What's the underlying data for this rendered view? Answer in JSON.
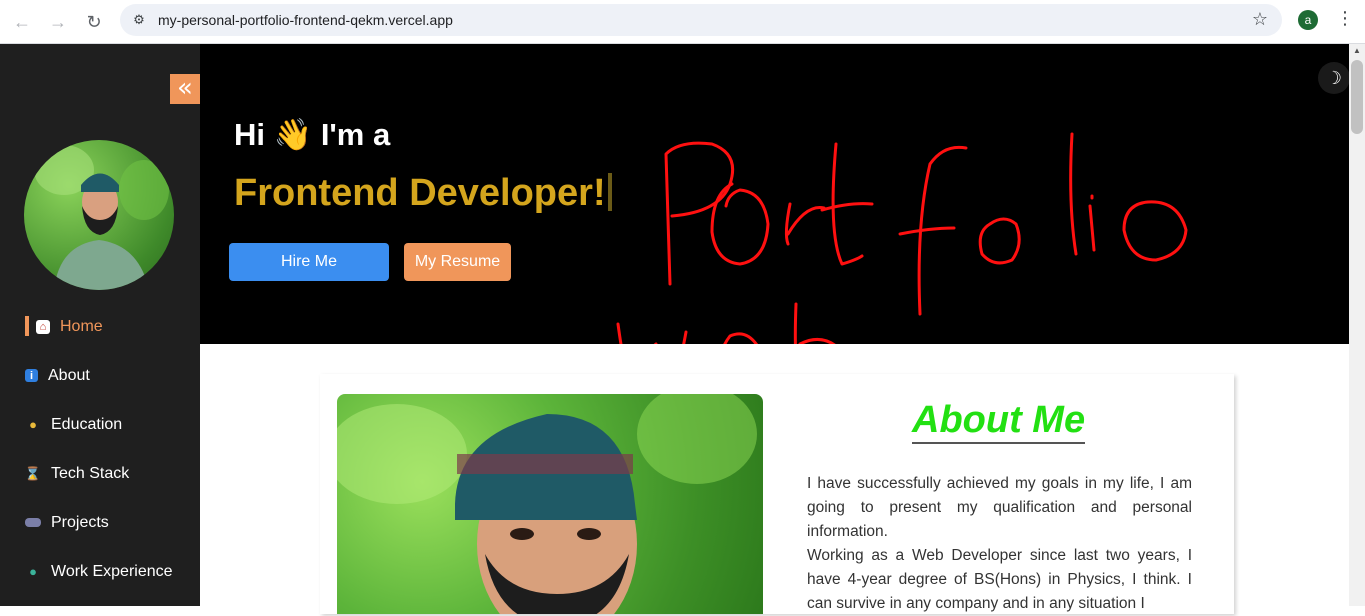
{
  "browser": {
    "url": "my-personal-portfolio-frontend-qekm.vercel.app",
    "profile_initial": "a",
    "icons": {
      "back": "back-arrow-icon",
      "forward": "forward-arrow-icon",
      "reload": "reload-icon",
      "site_info": "tune-icon",
      "bookmark": "star-icon",
      "menu": "kebab-menu-icon"
    }
  },
  "sidebar": {
    "collapse_glyph": "«",
    "items": [
      {
        "label": "Home",
        "icon": "house-icon",
        "active": true
      },
      {
        "label": "About",
        "icon": "info-icon",
        "active": false
      },
      {
        "label": "Education",
        "icon": "student-icon",
        "active": false
      },
      {
        "label": "Tech Stack",
        "icon": "hourglass-icon",
        "active": false
      },
      {
        "label": "Projects",
        "icon": "controller-icon",
        "active": false
      },
      {
        "label": "Work Experience",
        "icon": "worker-icon",
        "active": false
      }
    ]
  },
  "hero": {
    "greeting": "Hi 👋 I'm a",
    "role": "Frontend Developer!",
    "hire_label": "Hire Me",
    "resume_label": "My Resume",
    "colors": {
      "role": "#d4a51d",
      "hire": "#3b8ef0",
      "resume": "#f0965a"
    }
  },
  "about": {
    "title": "About Me",
    "paragraphs": [
      "I have successfully achieved my goals in my life, I am going to present my qualification and personal information.",
      "Working as a Web Developer since last two years, I have 4-year degree of BS(Hons) in Physics, I think. I can survive in any company and in any situation I"
    ],
    "title_color": "#22e012"
  },
  "accent_color": "#f0965a"
}
